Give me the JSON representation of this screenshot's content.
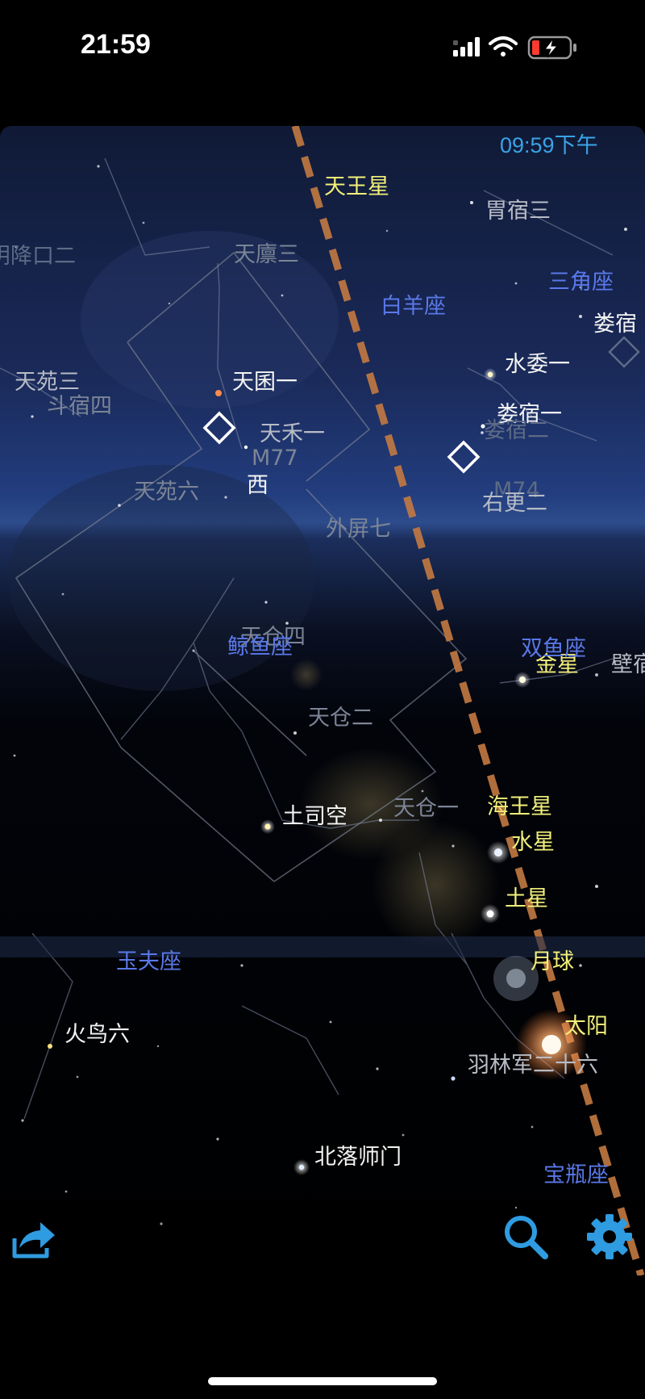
{
  "status_bar": {
    "time": "21:59",
    "signal_icon": "signal-bars-icon",
    "wifi_icon": "wifi-icon",
    "battery_icon": "battery-charging-icon"
  },
  "sky_view": {
    "clock": "09:59下午",
    "planets": {
      "uranus": "天王星",
      "neptune": "海王星",
      "mercury": "水星",
      "saturn": "土星",
      "venus": "金星",
      "moon": "月球",
      "sun": "太阳"
    },
    "stars": {
      "weisu3": "胃宿三",
      "tianlin3": "天廪三",
      "tianyuan3": "天苑三",
      "dousu4": "斗宿四",
      "tianqun1": "天囷一",
      "tianhe1": "天禾一",
      "tianyuan6": "天苑六",
      "xi": "西",
      "shuiwei1": "水委一",
      "lousu1": "娄宿一",
      "lousu_edge": "娄宿",
      "lousu_dim": "娄宿二",
      "yougeng2": "右更二",
      "waiping7": "外屏七",
      "tiancang4": "天仓四",
      "tiancang2": "天仓二",
      "tiancang1": "天仓一",
      "tusikong": "土司空",
      "huoniao6": "火鸟六",
      "yulinjun26": "羽林军二十六",
      "beiluoshimen": "北落师门",
      "bi_edge": "壁宿",
      "partial_left": "天苑",
      "partial_upper_left": "阴降口二"
    },
    "constellations": {
      "aries": "白羊座",
      "triangulum": "三角座",
      "cetus": "鲸鱼座",
      "pisces": "双鱼座",
      "phoenix": "玉夫座",
      "aquarius": "宝瓶座"
    },
    "deep_sky": {
      "m77": "M77",
      "m74": "M74"
    }
  },
  "toolbar": {
    "share_icon": "share-icon",
    "search_icon": "search-icon",
    "settings_icon": "gear-icon"
  },
  "colors": {
    "clock": "#3aa3e6",
    "planet_label": "#f2f07a",
    "constellation_label": "#5a78e8",
    "ecliptic": "#c07b4a",
    "toolbar_icon": "#2f9be0"
  }
}
